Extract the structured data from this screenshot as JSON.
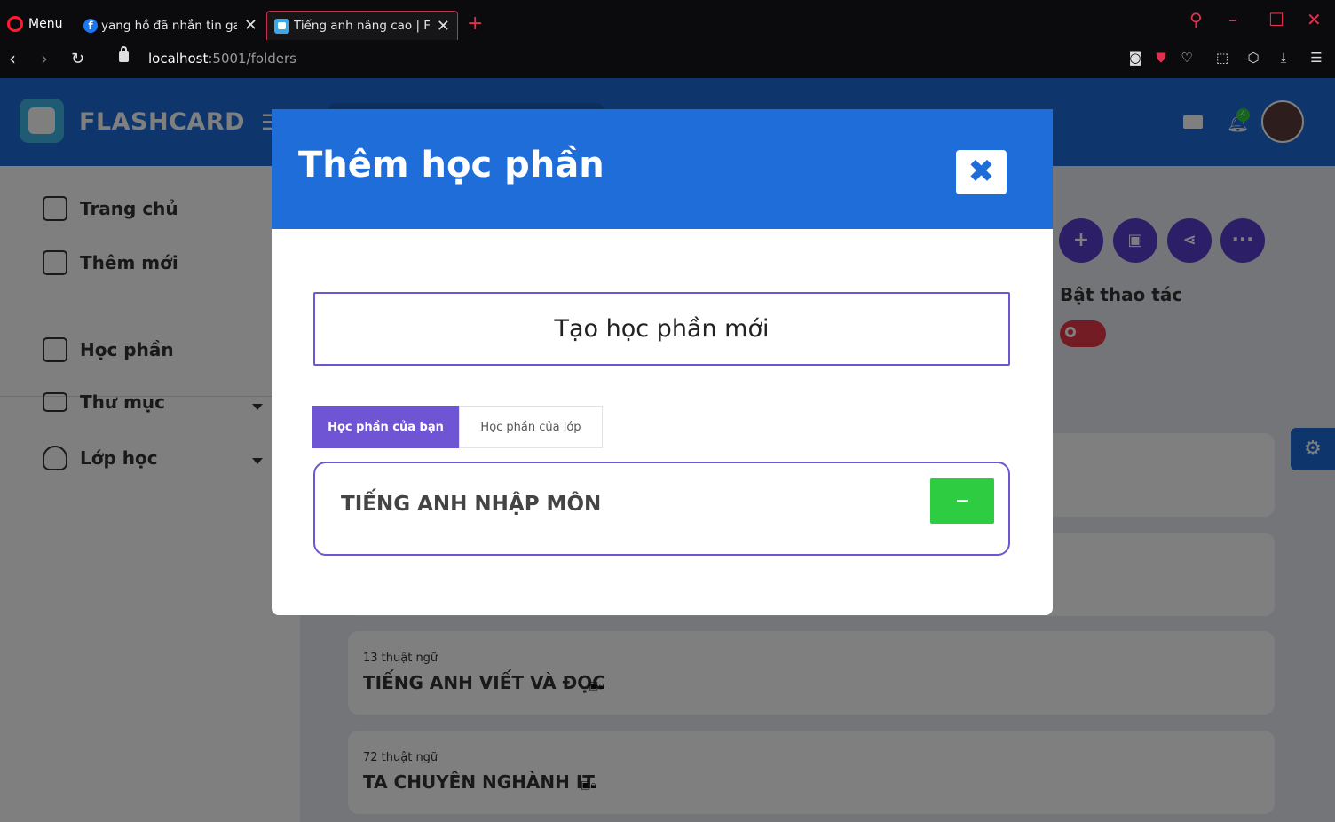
{
  "browser": {
    "menu_label": "Menu",
    "tabs": [
      {
        "title": "yang hồ đã nhắn tin gay"
      },
      {
        "title": "Tiếng anh nâng cao | Flas"
      }
    ],
    "url_host": "localhost",
    "url_rest": ":5001/folders"
  },
  "app": {
    "brand": "FLASHCARD",
    "notification_count": "4",
    "sidebar": [
      {
        "label": "Trang chủ"
      },
      {
        "label": "Thêm mới"
      },
      {
        "label": "Học phần"
      },
      {
        "label": "Thư mục"
      },
      {
        "label": "Lớp học"
      }
    ],
    "toggle_label": "Bật thao tác",
    "cards": [
      {
        "terms": "13 thuật ngữ",
        "title": "TIẾNG ANH VIẾT VÀ ĐỌC"
      },
      {
        "terms": "72 thuật ngữ",
        "title": "TA CHUYÊN NGHÀNH IT"
      }
    ]
  },
  "modal": {
    "title": "Thêm học phần",
    "create_label": "Tạo học phần mới",
    "tab_mine": "Học phần của bạn",
    "tab_class": "Học phần của lớp",
    "sets": [
      {
        "name": "TIẾNG ANH NHẬP MÔN"
      }
    ]
  },
  "colors": {
    "primary": "#1e6dd8",
    "accent": "#6f55d3",
    "success": "#2ecc40",
    "danger": "#e63946"
  }
}
